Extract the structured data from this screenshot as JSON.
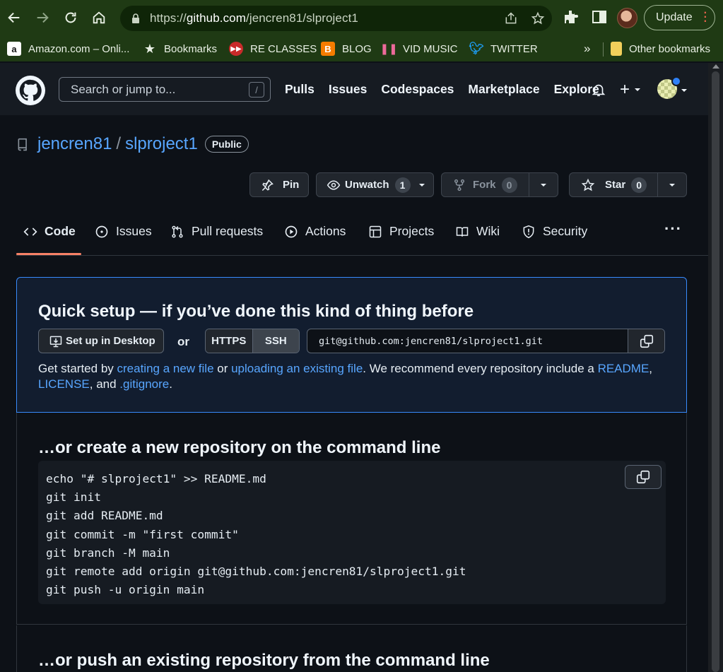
{
  "browser": {
    "url_prefix": "https://",
    "url_host": "github.com",
    "url_path": "/jencren81/slproject1",
    "update_label": "Update",
    "accent": "#1f3a14"
  },
  "bookmarks": {
    "items": [
      "Amazon.com – Onli...",
      "Bookmarks",
      "RE CLASSES",
      "BLOG",
      "VID MUSIC",
      "TWITTER"
    ],
    "overflow": "»",
    "other": "Other bookmarks"
  },
  "github": {
    "search_placeholder": "Search or jump to...",
    "search_shortcut": "/",
    "nav": [
      "Pulls",
      "Issues",
      "Codespaces",
      "Marketplace",
      "Explore"
    ],
    "plus": "+"
  },
  "repo": {
    "owner": "jencren81",
    "separator": "/",
    "name": "slproject1",
    "visibility": "Public",
    "pin_label": "Pin",
    "unwatch_label": "Unwatch",
    "watch_count": "1",
    "fork_label": "Fork",
    "fork_count": "0",
    "star_label": "Star",
    "star_count": "0"
  },
  "tabs": [
    "Code",
    "Issues",
    "Pull requests",
    "Actions",
    "Projects",
    "Wiki",
    "Security"
  ],
  "tabs_more": "···",
  "quick_setup": {
    "title": "Quick setup — if you’ve done this kind of thing before",
    "desktop_label": "Set up in Desktop",
    "or": "or",
    "https": "HTTPS",
    "ssh": "SSH",
    "clone_url": "git@github.com:jencren81/slproject1.git",
    "desc_1": "Get started by ",
    "link_new_file": "creating a new file",
    "desc_2": " or ",
    "link_upload": "uploading an existing file",
    "desc_3": ". We recommend every repository include a ",
    "link_readme": "README",
    "desc_4": ", ",
    "link_license": "LICENSE",
    "desc_5": ", and ",
    "link_gitignore": ".gitignore",
    "desc_6": "."
  },
  "new_repo": {
    "title": "…or create a new repository on the command line",
    "lines": [
      "echo \"# slproject1\" >> README.md",
      "git init",
      "git add README.md",
      "git commit -m \"first commit\"",
      "git branch -M main",
      "git remote add origin git@github.com:jencren81/slproject1.git",
      "git push -u origin main"
    ]
  },
  "push_existing": {
    "title": "…or push an existing repository from the command line"
  }
}
